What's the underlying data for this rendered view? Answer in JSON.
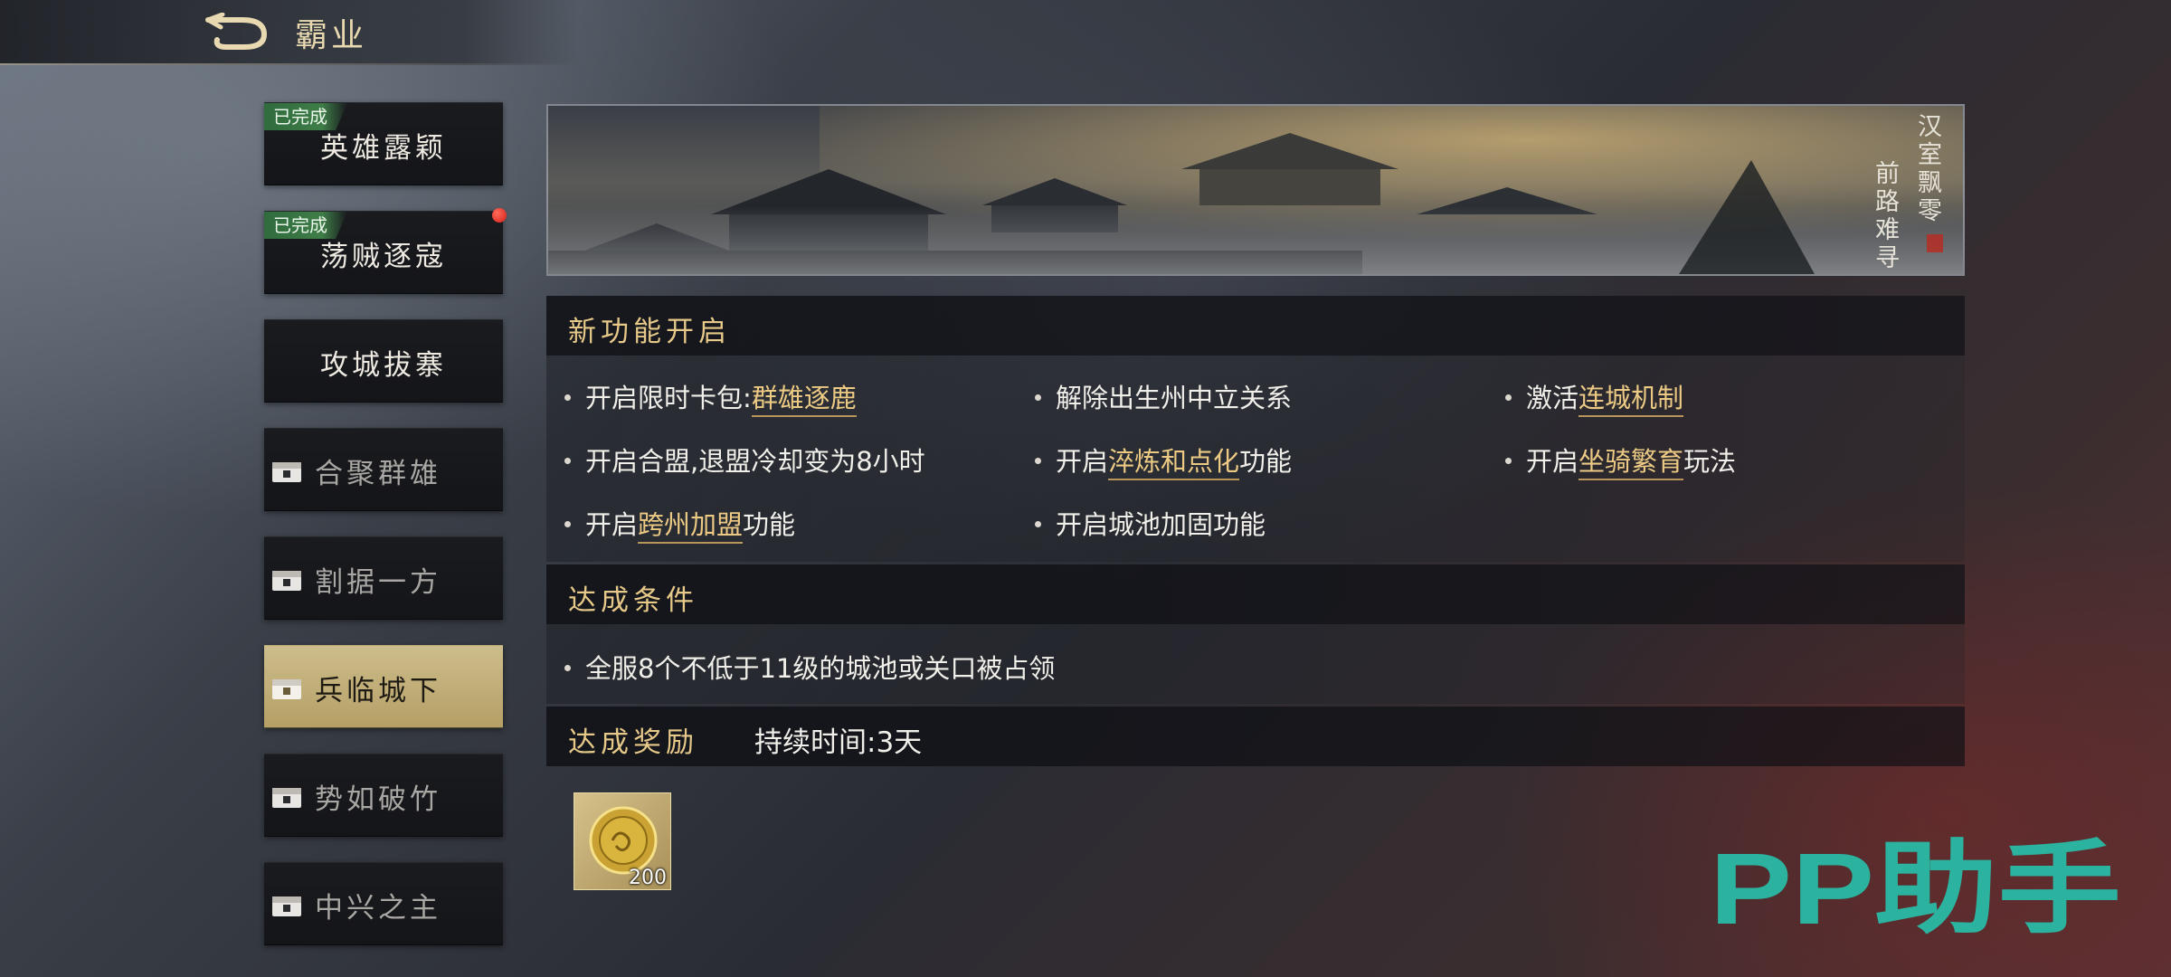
{
  "header": {
    "title": "霸业"
  },
  "sidebar": {
    "items": [
      {
        "label": "英雄露颖",
        "badge": "已完成"
      },
      {
        "label": "荡贼逐寇",
        "badge": "已完成"
      },
      {
        "label": "攻城拔寨"
      },
      {
        "label": "合聚群雄"
      },
      {
        "label": "割据一方"
      },
      {
        "label": "兵临城下"
      },
      {
        "label": "势如破竹"
      },
      {
        "label": "中兴之主"
      }
    ]
  },
  "banner": {
    "poem_line1": "汉室飘零",
    "poem_line2": "前路难寻"
  },
  "features": {
    "title": "新功能开启",
    "items": [
      {
        "pre": "开启限时卡包:",
        "hl": "群雄逐鹿",
        "post": ""
      },
      {
        "pre": "解除出生州中立关系",
        "hl": "",
        "post": ""
      },
      {
        "pre": "激活",
        "hl": "连城机制",
        "post": ""
      },
      {
        "pre": "开启合盟,退盟冷却变为8小时",
        "hl": "",
        "post": ""
      },
      {
        "pre": "开启",
        "hl": "淬炼和点化",
        "post": "功能"
      },
      {
        "pre": "开启",
        "hl": "坐骑繁育",
        "post": "玩法"
      },
      {
        "pre": "开启",
        "hl": "跨州加盟",
        "post": "功能"
      },
      {
        "pre": "开启城池加固功能",
        "hl": "",
        "post": ""
      }
    ]
  },
  "conditions": {
    "title": "达成条件",
    "items": [
      "全服8个不低于11级的城池或关口被占领"
    ]
  },
  "rewards": {
    "title": "达成奖励",
    "duration": "持续时间:3天",
    "items": [
      {
        "icon": "gold-coin-icon",
        "quantity": "200"
      }
    ]
  },
  "watermark": "PP助手",
  "colors": {
    "accent_gold": "#e6c989",
    "highlight": "#ecca84",
    "done_green": "#3f7d48",
    "watermark_teal": "#2bb3a0"
  }
}
